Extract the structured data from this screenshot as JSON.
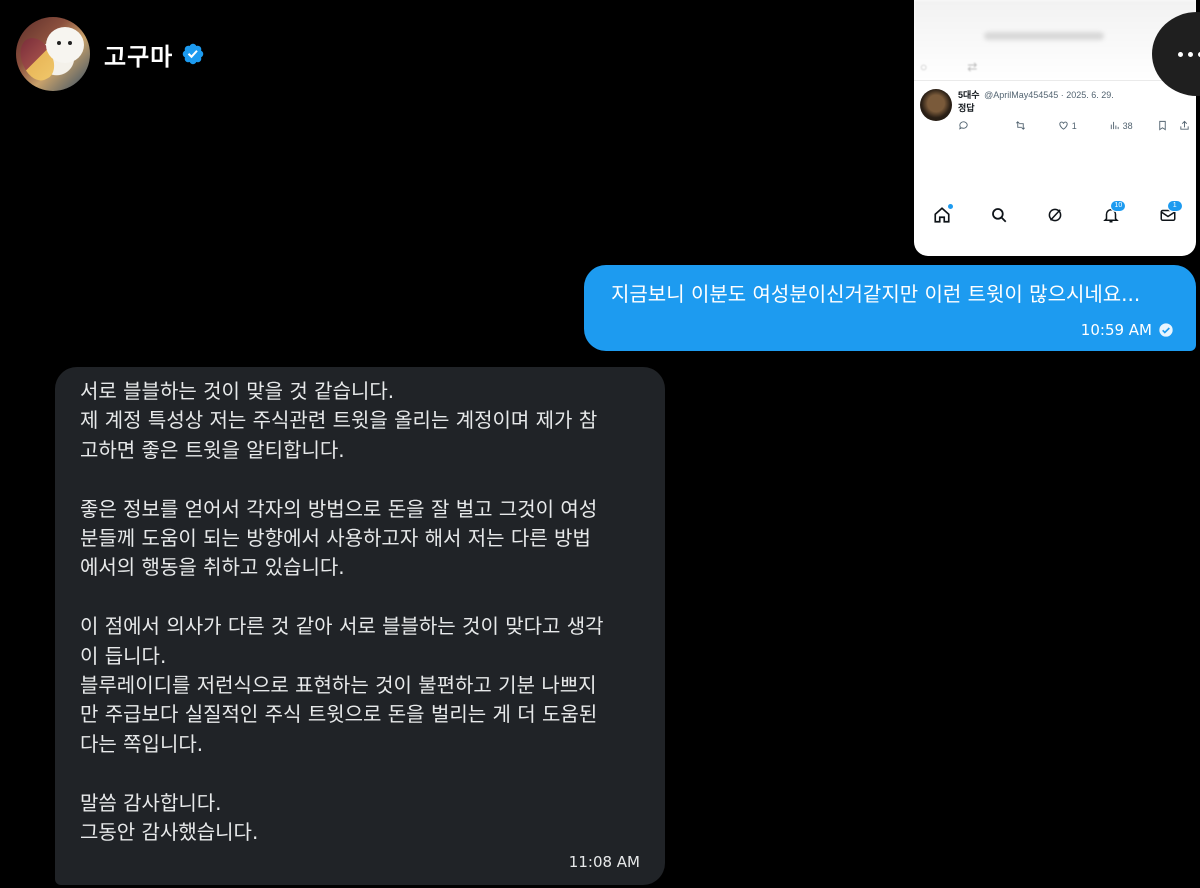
{
  "header": {
    "username": "고구마",
    "verified": true
  },
  "embedded_screenshot": {
    "tweet": {
      "author_name": "5대수",
      "handle_date": "@AprilMay454545 · 2025. 6. 29.",
      "text": "정답",
      "likes": "1",
      "views": "38"
    },
    "nav": {
      "notifications_badge": "10",
      "messages_badge": "1"
    }
  },
  "messages": {
    "sent": {
      "text": "지금보니 이분도 여성분이신거같지만 이런 트윗이 많으시네요...",
      "time": "10:59 AM"
    },
    "received": {
      "text": "서로 블블하는 것이 맞을 것 같습니다.\n제 계정 특성상 저는 주식관련 트윗을 올리는 계정이며 제가 참\n고하면 좋은 트윗을 알티합니다.\n\n좋은 정보를 얻어서 각자의 방법으로 돈을 잘 벌고 그것이 여성\n분들께 도움이 되는 방향에서 사용하고자 해서 저는 다른 방법\n에서의 행동을 취하고 있습니다.\n\n이 점에서 의사가 다른 것 같아 서로 블블하는 것이 맞다고 생각\n이 듭니다.\n블루레이디를 저런식으로 표현하는 것이 불편하고 기분 나쁘지\n만 주급보다 실질적인 주식 트윗으로 돈을 벌리는 게 더 도움된\n다는 쪽입니다.\n\n말씀 감사합니다.\n그동안 감사했습니다.",
      "time": "11:08 AM"
    }
  },
  "colors": {
    "background": "#000000",
    "sent_bubble": "#1d9bf0",
    "received_bubble": "#202327",
    "verified_badge": "#1d9bf0"
  }
}
